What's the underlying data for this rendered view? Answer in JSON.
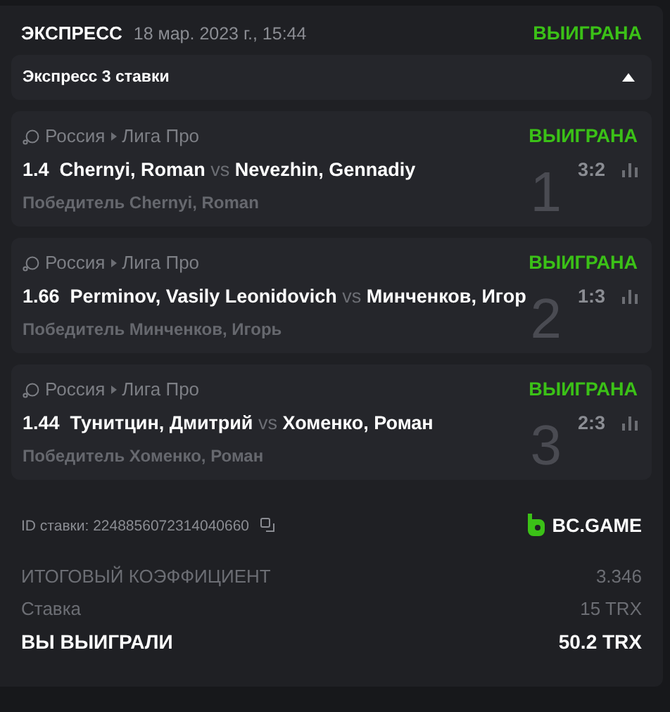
{
  "header": {
    "title": "ЭКСПРЕСС",
    "date": "18 мар. 2023 г., 15:44",
    "status": "ВЫИГРАНА"
  },
  "section": {
    "title": "Экспресс 3 ставки",
    "expanded": true
  },
  "bets": [
    {
      "index": "1",
      "country": "Россия",
      "league": "Лига Про",
      "status": "ВЫИГРАНА",
      "odds": "1.4",
      "home": "Chernyi, Roman",
      "vs": "vs",
      "away": "Nevezhin, Gennadiy",
      "score": "3:2",
      "selection": "Победитель Chernyi, Roman"
    },
    {
      "index": "2",
      "country": "Россия",
      "league": "Лига Про",
      "status": "ВЫИГРАНА",
      "odds": "1.66",
      "home": "Perminov, Vasily Leonidovich",
      "vs": "vs",
      "away": "Минченков, Игор",
      "score": "1:3",
      "selection": "Победитель Минченков, Игорь"
    },
    {
      "index": "3",
      "country": "Россия",
      "league": "Лига Про",
      "status": "ВЫИГРАНА",
      "odds": "1.44",
      "home": "Тунитцин, Дмитрий",
      "vs": "vs",
      "away": "Хоменко, Роман",
      "score": "2:3",
      "selection": "Победитель Хоменко, Роман"
    }
  ],
  "bet_id": "ID ставки: 2248856072314040660",
  "brand": "BC.GAME",
  "summary": [
    {
      "kind": "muted",
      "label": "ИТОГОВЫЙ КОЭФФИЦИЕНТ",
      "value": "3.346"
    },
    {
      "kind": "muted",
      "label": "Ставка",
      "value": "15 TRX"
    },
    {
      "kind": "total",
      "label": "ВЫ ВЫИГРАЛИ",
      "value": "50.2 TRX"
    }
  ]
}
